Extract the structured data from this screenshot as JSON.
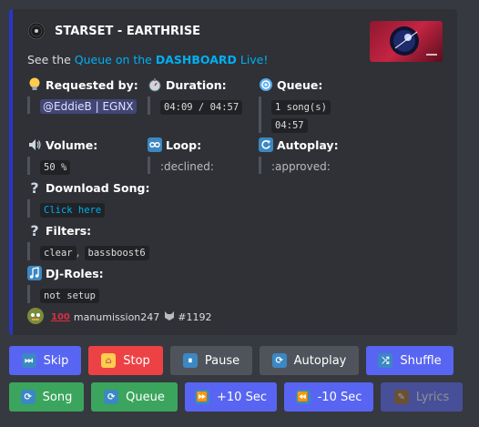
{
  "embed": {
    "accent_color": "#2b35c9",
    "author": {
      "icon": "vinyl-record-icon",
      "name": "STARSET - EARTHRISE"
    },
    "description": {
      "prefix": "See the ",
      "link": "Queue on the ",
      "bold": "DASHBOARD",
      "suffix": " Live!"
    },
    "fields": {
      "requested_by": {
        "icon": "lightbulb-icon",
        "label": "Requested by:",
        "value": "@EddieB | EGNX"
      },
      "duration": {
        "icon": "stopwatch-icon",
        "label": "Duration:",
        "value": "04:09 / 04:57"
      },
      "queue": {
        "icon": "cyclone-icon",
        "label": "Queue:",
        "value_line1": "1 song(s)",
        "value_line2": "04:57"
      },
      "volume": {
        "icon": "speaker-icon",
        "label": "Volume:",
        "value": "50 %"
      },
      "loop": {
        "icon": "infinity-icon",
        "label": "Loop:",
        "value": ":declined:"
      },
      "autoplay": {
        "icon": "autoplay-arrow-icon",
        "label": "Autoplay:",
        "value": ":approved:"
      },
      "download": {
        "icon": "question-mark-icon",
        "label": "Download Song:",
        "value": "Click here"
      },
      "filters": {
        "icon": "question-mark-icon",
        "label": "Filters:",
        "value1": "clear",
        "sep": ",",
        "value2": "bassboost6"
      },
      "dj_roles": {
        "icon": "music-note-icon",
        "label": "DJ-Roles:",
        "value": "not setup"
      }
    },
    "footer": {
      "avatar": "avatar-icon",
      "emoji": "100-icon",
      "user": "manumission247",
      "badge": "cat-icon",
      "tag": "#1192"
    }
  },
  "buttons_row1": [
    {
      "label": "Skip",
      "icon": "skip-icon",
      "color": "#5865f2"
    },
    {
      "label": "Stop",
      "icon": "house-icon",
      "color": "#ed4245"
    },
    {
      "label": "Pause",
      "icon": "pause-icon",
      "color": "#4f545c"
    },
    {
      "label": "Autoplay",
      "icon": "repeat-icon",
      "color": "#4f545c"
    },
    {
      "label": "Shuffle",
      "icon": "shuffle-icon",
      "color": "#5865f2"
    }
  ],
  "buttons_row2": [
    {
      "label": "Song",
      "icon": "repeat-one-icon",
      "color": "#3ba55d"
    },
    {
      "label": "Queue",
      "icon": "repeat-icon",
      "color": "#3ba55d"
    },
    {
      "label": "+10 Sec",
      "icon": "fast-forward-icon",
      "color": "#5865f2"
    },
    {
      "label": "-10 Sec",
      "icon": "rewind-icon",
      "color": "#5865f2"
    },
    {
      "label": "Lyrics",
      "icon": "pencil-icon",
      "color": "#5865f2"
    }
  ]
}
